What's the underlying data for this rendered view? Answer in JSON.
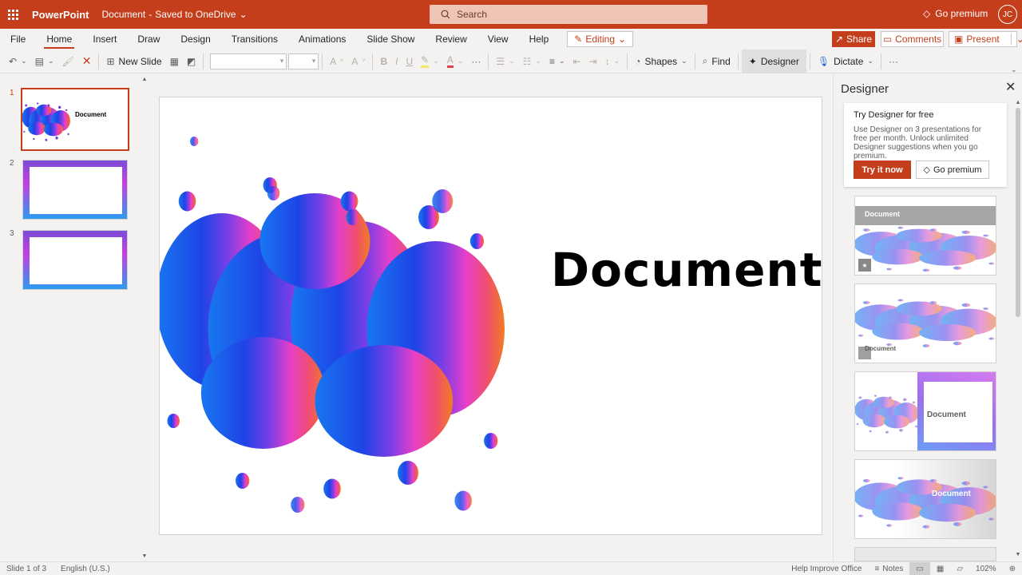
{
  "titlebar": {
    "app_name": "PowerPoint",
    "doc_name": "Document",
    "doc_status": "Saved to OneDrive",
    "search_placeholder": "Search",
    "premium_label": "Go premium",
    "avatar_initials": "JC",
    "bg_color": "#c43e1c"
  },
  "menu": {
    "tabs": [
      "File",
      "Home",
      "Insert",
      "Draw",
      "Design",
      "Transitions",
      "Animations",
      "Slide Show",
      "Review",
      "View",
      "Help"
    ],
    "active_tab": "Home",
    "editing_label": "Editing",
    "share_label": "Share",
    "comments_label": "Comments",
    "present_label": "Present"
  },
  "toolbar": {
    "new_slide_label": "New Slide",
    "shapes_label": "Shapes",
    "find_label": "Find",
    "designer_label": "Designer",
    "dictate_label": "Dictate"
  },
  "slides": {
    "numbers": [
      "1",
      "2",
      "3"
    ],
    "thumb1_title": "Document",
    "selected": 1
  },
  "slide": {
    "title": "Document"
  },
  "designer": {
    "title": "Designer",
    "promo_heading": "Try Designer for free",
    "promo_body": "Use Designer on 3 presentations for free per month. Unlock unlimited Designer suggestions when you go premium.",
    "try_label": "Try it now",
    "premium_label": "Go premium",
    "card_titles": [
      "Document",
      "Document",
      "Document",
      "Document"
    ]
  },
  "status": {
    "slide_info": "Slide 1 of 3",
    "language": "English (U.S.)",
    "help_improve": "Help Improve Office",
    "notes_label": "Notes",
    "zoom": "102%"
  }
}
